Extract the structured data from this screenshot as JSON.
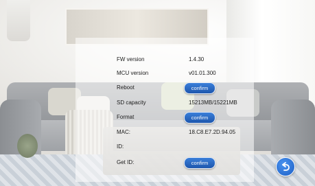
{
  "settings": {
    "fw_version": {
      "label": "FW version",
      "value": "1.4.30"
    },
    "mcu_version": {
      "label": "MCU version",
      "value": "v01.01.300"
    },
    "reboot": {
      "label": "Reboot",
      "button": "confirm"
    },
    "sd_capacity": {
      "label": "SD capacity",
      "value": "15213MB/15221MB"
    },
    "format": {
      "label": "Format",
      "button": "confirm"
    },
    "mac": {
      "label": "MAC:",
      "value": "18.C8.E7.2D.94.05"
    },
    "id": {
      "label": "ID:",
      "value": ""
    },
    "get_id": {
      "label": "Get ID:",
      "button": "confirm"
    }
  },
  "icons": {
    "back": "back-arrow-icon"
  },
  "colors": {
    "button": "#2563c0",
    "back_button": "#1d5fc4"
  }
}
